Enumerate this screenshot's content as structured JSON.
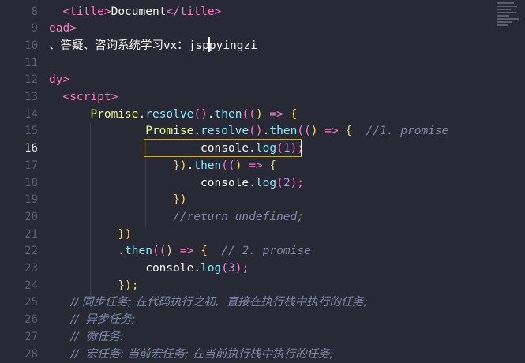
{
  "editor": {
    "active_line": "16",
    "lines": [
      {
        "num": "8",
        "parts": [
          {
            "t": "  ",
            "c": "t-text"
          },
          {
            "t": "<",
            "c": "t-tag"
          },
          {
            "t": "title",
            "c": "t-tag"
          },
          {
            "t": ">",
            "c": "t-tag"
          },
          {
            "t": "Document",
            "c": "t-text"
          },
          {
            "t": "</",
            "c": "t-tag"
          },
          {
            "t": "title",
            "c": "t-tag"
          },
          {
            "t": ">",
            "c": "t-tag"
          }
        ]
      },
      {
        "num": "9",
        "parts": [
          {
            "t": "ead",
            "c": "t-tag"
          },
          {
            "t": ">",
            "c": "t-tag"
          }
        ]
      },
      {
        "num": "10",
        "parts": [
          {
            "t": "、答疑、咨询系统学习vx：",
            "c": "t-text t-cjk"
          },
          {
            "t": "jsppyingzi",
            "c": "t-text"
          }
        ]
      },
      {
        "num": "11",
        "parts": []
      },
      {
        "num": "12",
        "parts": [
          {
            "t": "dy",
            "c": "t-tag"
          },
          {
            "t": ">",
            "c": "t-tag"
          }
        ]
      },
      {
        "num": "13",
        "parts": [
          {
            "t": "  ",
            "c": "t-text"
          },
          {
            "t": "<",
            "c": "t-tag"
          },
          {
            "t": "script",
            "c": "t-tag"
          },
          {
            "t": ">",
            "c": "t-tag"
          }
        ]
      },
      {
        "num": "14",
        "parts": [
          {
            "t": "      Promise",
            "c": "t-fn"
          },
          {
            "t": ".",
            "c": "t-punc"
          },
          {
            "t": "resolve",
            "c": "t-method"
          },
          {
            "t": "()",
            "c": "t-paren1"
          },
          {
            "t": ".",
            "c": "t-punc"
          },
          {
            "t": "then",
            "c": "t-method"
          },
          {
            "t": "((",
            "c": "t-paren1"
          },
          {
            "t": ") ",
            "c": "t-paren2"
          },
          {
            "t": "=>",
            "c": "t-arrow"
          },
          {
            "t": " {",
            "c": "t-paren2"
          }
        ]
      },
      {
        "num": "15",
        "parts": [
          {
            "t": "              Promise",
            "c": "t-fn"
          },
          {
            "t": ".",
            "c": "t-punc"
          },
          {
            "t": "resolve",
            "c": "t-method"
          },
          {
            "t": "()",
            "c": "t-paren1"
          },
          {
            "t": ".",
            "c": "t-punc"
          },
          {
            "t": "then",
            "c": "t-method"
          },
          {
            "t": "((",
            "c": "t-paren1"
          },
          {
            "t": ") ",
            "c": "t-paren2"
          },
          {
            "t": "=>",
            "c": "t-arrow"
          },
          {
            "t": " {",
            "c": "t-paren2"
          },
          {
            "t": "  //1. promise",
            "c": "t-comment"
          }
        ]
      },
      {
        "num": "16",
        "parts": [
          {
            "t": "                      console",
            "c": "t-text"
          },
          {
            "t": ".",
            "c": "t-punc"
          },
          {
            "t": "log",
            "c": "t-method"
          },
          {
            "t": "(",
            "c": "t-paren1"
          },
          {
            "t": "1",
            "c": "t-num"
          },
          {
            "t": ");",
            "c": "t-paren1"
          }
        ]
      },
      {
        "num": "17",
        "parts": [
          {
            "t": "                  })",
            "c": "t-paren2"
          },
          {
            "t": ".",
            "c": "t-punc"
          },
          {
            "t": "then",
            "c": "t-method"
          },
          {
            "t": "((",
            "c": "t-paren1"
          },
          {
            "t": ") ",
            "c": "t-paren2"
          },
          {
            "t": "=>",
            "c": "t-arrow"
          },
          {
            "t": " {",
            "c": "t-paren2"
          }
        ]
      },
      {
        "num": "18",
        "parts": [
          {
            "t": "                      console",
            "c": "t-text"
          },
          {
            "t": ".",
            "c": "t-punc"
          },
          {
            "t": "log",
            "c": "t-method"
          },
          {
            "t": "(",
            "c": "t-paren1"
          },
          {
            "t": "2",
            "c": "t-num"
          },
          {
            "t": ");",
            "c": "t-paren1"
          }
        ]
      },
      {
        "num": "19",
        "parts": [
          {
            "t": "                  })",
            "c": "t-paren2"
          }
        ]
      },
      {
        "num": "20",
        "parts": [
          {
            "t": "                  //return undefined;",
            "c": "t-comment"
          }
        ]
      },
      {
        "num": "21",
        "parts": [
          {
            "t": "          })",
            "c": "t-paren2"
          }
        ]
      },
      {
        "num": "22",
        "parts": [
          {
            "t": "          .",
            "c": "t-punc"
          },
          {
            "t": "then",
            "c": "t-method"
          },
          {
            "t": "((",
            "c": "t-paren1"
          },
          {
            "t": ") ",
            "c": "t-paren2"
          },
          {
            "t": "=>",
            "c": "t-arrow"
          },
          {
            "t": " {",
            "c": "t-paren2"
          },
          {
            "t": "  // 2. promise",
            "c": "t-comment"
          }
        ]
      },
      {
        "num": "23",
        "parts": [
          {
            "t": "              console",
            "c": "t-text"
          },
          {
            "t": ".",
            "c": "t-punc"
          },
          {
            "t": "log",
            "c": "t-method"
          },
          {
            "t": "(",
            "c": "t-paren1"
          },
          {
            "t": "3",
            "c": "t-num"
          },
          {
            "t": ");",
            "c": "t-paren1"
          }
        ]
      },
      {
        "num": "24",
        "parts": [
          {
            "t": "          });",
            "c": "t-paren2"
          }
        ]
      },
      {
        "num": "25",
        "parts": [
          {
            "t": "      // 同步任务; 在代码执行之初,  直接在执行栈中执行的任务;",
            "c": "t-comment t-cjk"
          }
        ]
      },
      {
        "num": "26",
        "parts": [
          {
            "t": "      //  异步任务;",
            "c": "t-comment t-cjk"
          }
        ]
      },
      {
        "num": "27",
        "parts": [
          {
            "t": "      //  微任务:",
            "c": "t-comment t-cjk"
          }
        ]
      },
      {
        "num": "28",
        "parts": [
          {
            "t": "      //  宏任务: 当前宏任务; 在当前执行栈中执行的任务;",
            "c": "t-comment t-cjk"
          }
        ]
      }
    ]
  }
}
